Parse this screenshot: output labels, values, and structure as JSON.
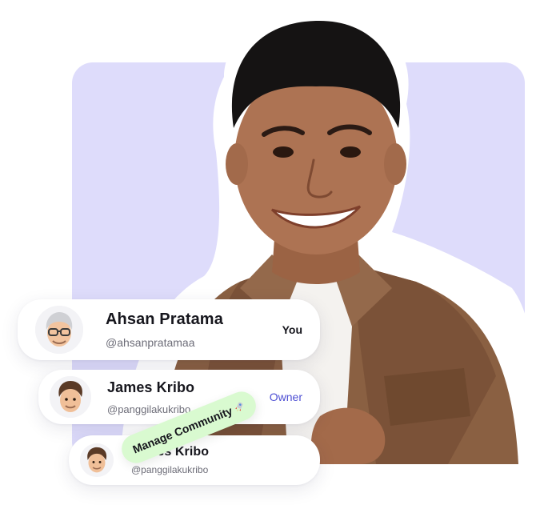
{
  "members": [
    {
      "name": "Ahsan Pratama",
      "handle": "@ahsanpratamaa",
      "role": "You",
      "avatar": "memoji-grey-hair-glasses-icon"
    },
    {
      "name": "James Kribo",
      "handle": "@panggilakukribo",
      "role": "Owner",
      "avatar": "memoji-curly-hair-icon"
    },
    {
      "name": "James Kribo",
      "handle": "@panggilakukribo",
      "role": "",
      "avatar": "memoji-curly-hair-icon"
    }
  ],
  "action_pill": {
    "label": "Manage Community",
    "icon": "rocket-icon"
  },
  "colors": {
    "backdrop": "#dedcfb",
    "owner_role": "#4e4fd3",
    "pill_bg": "#d9fad0",
    "text_primary": "#16161d",
    "text_secondary": "#6d6d78"
  }
}
